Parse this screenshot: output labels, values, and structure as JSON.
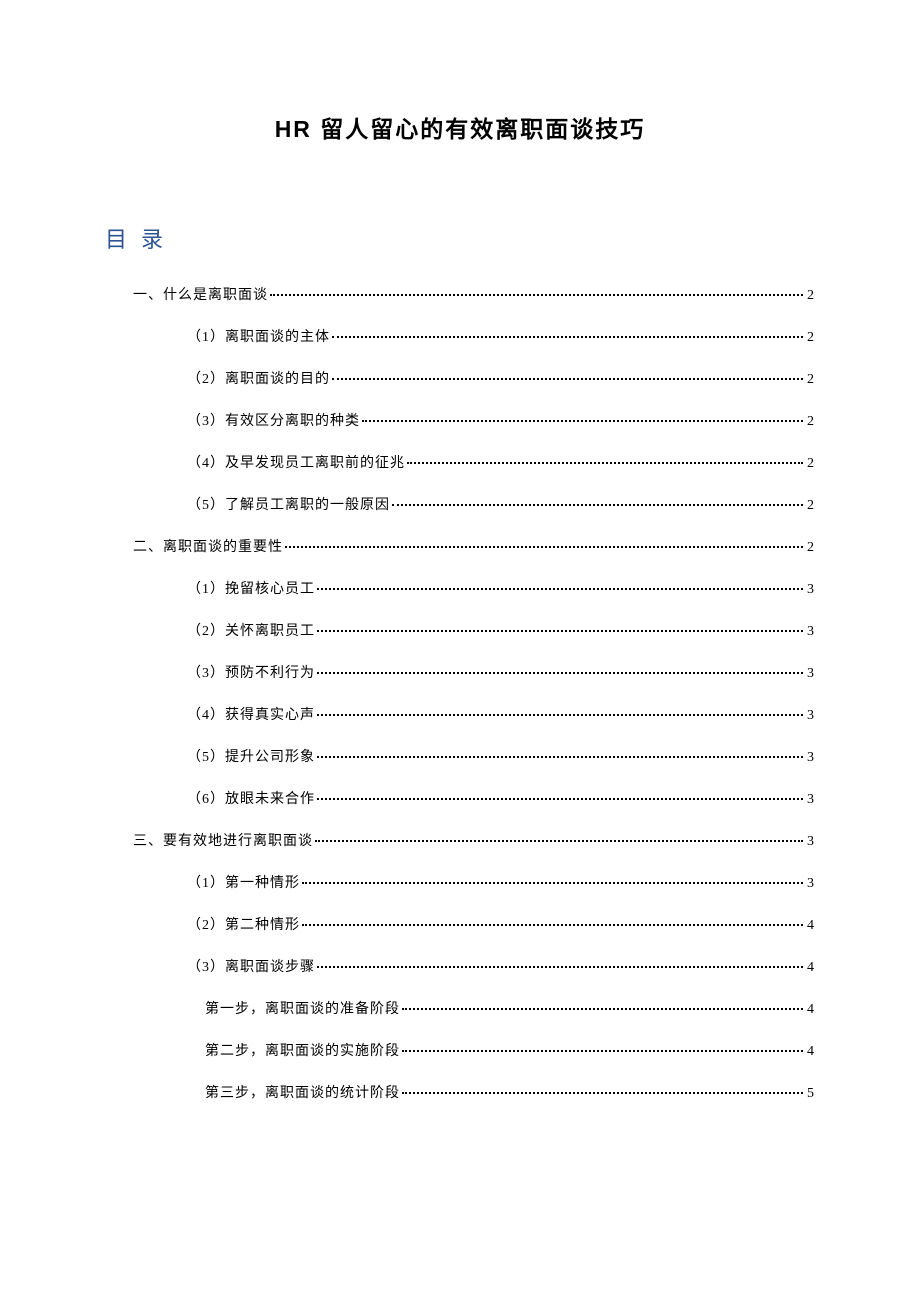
{
  "title": "HR 留人留心的有效离职面谈技巧",
  "tocHeader": "目录",
  "toc": [
    {
      "level": 1,
      "label": "一、什么是离职面谈",
      "page": "2"
    },
    {
      "level": 2,
      "label": "（1）离职面谈的主体",
      "page": "2"
    },
    {
      "level": 2,
      "label": "（2）离职面谈的目的",
      "page": "2"
    },
    {
      "level": 2,
      "label": "（3）有效区分离职的种类",
      "page": "2"
    },
    {
      "level": 2,
      "label": "（4）及早发现员工离职前的征兆",
      "page": "2"
    },
    {
      "level": 2,
      "label": "（5）了解员工离职的一般原因",
      "page": "2"
    },
    {
      "level": 1,
      "label": "二、离职面谈的重要性",
      "page": "2"
    },
    {
      "level": 2,
      "label": "（1）挽留核心员工",
      "page": "3"
    },
    {
      "level": 2,
      "label": "（2）关怀离职员工",
      "page": "3"
    },
    {
      "level": 2,
      "label": "（3）预防不利行为",
      "page": "3"
    },
    {
      "level": 2,
      "label": "（4）获得真实心声",
      "page": "3"
    },
    {
      "level": 2,
      "label": "（5）提升公司形象",
      "page": "3"
    },
    {
      "level": 2,
      "label": "（6）放眼未来合作",
      "page": "3"
    },
    {
      "level": 1,
      "label": "三、要有效地进行离职面谈",
      "page": "3"
    },
    {
      "level": 2,
      "label": "（1）第一种情形",
      "page": "3"
    },
    {
      "level": 2,
      "label": "（2）第二种情形",
      "page": "4"
    },
    {
      "level": 2,
      "label": "（3）离职面谈步骤",
      "page": "4"
    },
    {
      "level": 3,
      "label": "第一步，离职面谈的准备阶段",
      "page": "4"
    },
    {
      "level": 3,
      "label": "第二步，离职面谈的实施阶段",
      "page": "4"
    },
    {
      "level": 3,
      "label": "第三步，离职面谈的统计阶段",
      "page": "5"
    }
  ]
}
